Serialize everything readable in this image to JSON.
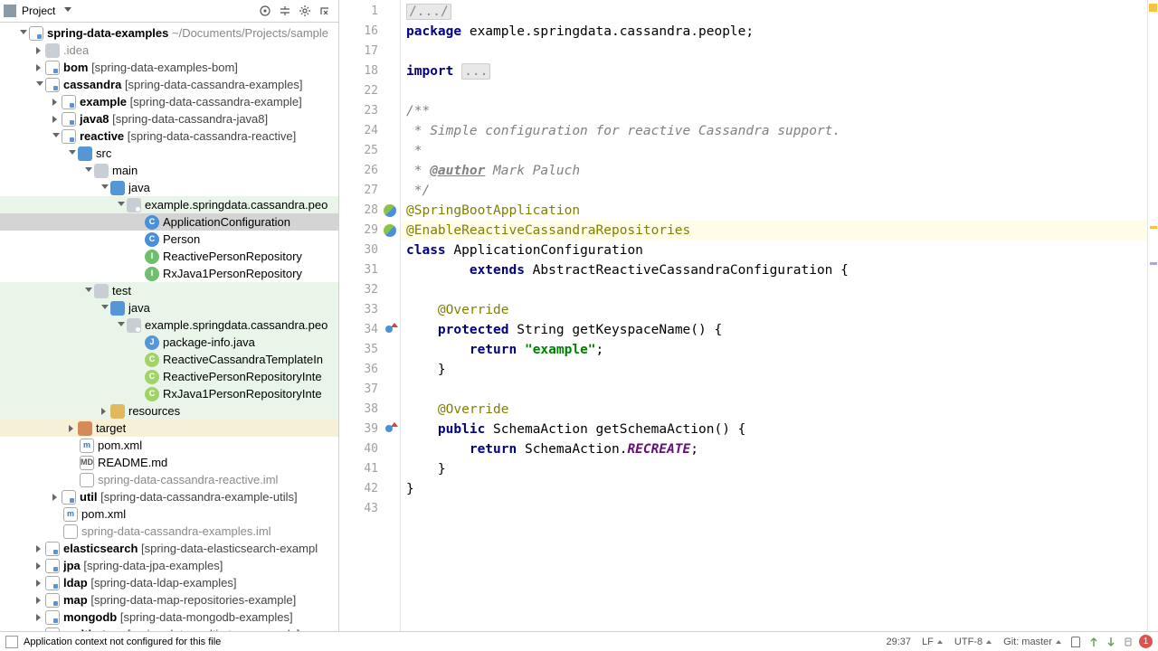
{
  "sidebar": {
    "title": "Project",
    "root": {
      "name": "spring-data-examples",
      "path": "~/Documents/Projects/sample"
    },
    "rows": [
      {
        "d": 1,
        "a": "down",
        "i": "module",
        "label": "spring-data-examples",
        "suffix": "~/Documents/Projects/sample",
        "bold": true,
        "part2": ""
      },
      {
        "d": 2,
        "a": "right",
        "i": "folder",
        "label": ".idea",
        "dim": true
      },
      {
        "d": 2,
        "a": "right",
        "i": "module",
        "label": "bom ",
        "part2": "[spring-data-examples-bom]",
        "bold": true
      },
      {
        "d": 2,
        "a": "down",
        "i": "module",
        "label": "cassandra ",
        "part2": "[spring-data-cassandra-examples]",
        "bold": true
      },
      {
        "d": 3,
        "a": "right",
        "i": "module",
        "label": "example ",
        "part2": "[spring-data-cassandra-example]",
        "bold": true
      },
      {
        "d": 3,
        "a": "right",
        "i": "module",
        "label": "java8 ",
        "part2": "[spring-data-cassandra-java8]",
        "bold": true
      },
      {
        "d": 3,
        "a": "down",
        "i": "module",
        "label": "reactive ",
        "part2": "[spring-data-cassandra-reactive]",
        "bold": true
      },
      {
        "d": 4,
        "a": "down",
        "i": "folder-src",
        "label": "src"
      },
      {
        "d": 5,
        "a": "down",
        "i": "folder",
        "label": "main"
      },
      {
        "d": 6,
        "a": "down",
        "i": "folder-src",
        "label": "java"
      },
      {
        "d": 7,
        "a": "down",
        "i": "folder-pkg",
        "label": "example.springdata.cassandra.peo",
        "hl": "green"
      },
      {
        "d": 8,
        "a": "none",
        "i": "class-c",
        "label": "ApplicationConfiguration",
        "sel": true
      },
      {
        "d": 8,
        "a": "none",
        "i": "class-c",
        "label": "Person"
      },
      {
        "d": 8,
        "a": "none",
        "i": "class-i",
        "label": "ReactivePersonRepository"
      },
      {
        "d": 8,
        "a": "none",
        "i": "class-i",
        "label": "RxJava1PersonRepository"
      },
      {
        "d": 5,
        "a": "down",
        "i": "folder",
        "label": "test",
        "hl": "green"
      },
      {
        "d": 6,
        "a": "down",
        "i": "folder-src",
        "label": "java",
        "hl": "green"
      },
      {
        "d": 7,
        "a": "down",
        "i": "folder-pkg",
        "label": "example.springdata.cassandra.peo",
        "hl": "green"
      },
      {
        "d": 8,
        "a": "none",
        "i": "java",
        "label": "package-info.java",
        "hl": "green"
      },
      {
        "d": 8,
        "a": "none",
        "i": "class-cg",
        "label": "ReactiveCassandraTemplateIn",
        "hl": "green"
      },
      {
        "d": 8,
        "a": "none",
        "i": "class-cg",
        "label": "ReactivePersonRepositoryInte",
        "hl": "green"
      },
      {
        "d": 8,
        "a": "none",
        "i": "class-cg",
        "label": "RxJava1PersonRepositoryInte",
        "hl": "green"
      },
      {
        "d": 6,
        "a": "right",
        "i": "folder-res",
        "label": "resources",
        "hl": "green"
      },
      {
        "d": 4,
        "a": "right",
        "i": "folder-tgt",
        "label": "target",
        "hl": "yellow"
      },
      {
        "d": 4,
        "a": "none",
        "i": "maven",
        "label": "pom.xml",
        "ic_text": "m"
      },
      {
        "d": 4,
        "a": "none",
        "i": "readme",
        "label": "README.md",
        "ic_text": "MD"
      },
      {
        "d": 4,
        "a": "none",
        "i": "iml",
        "label": "spring-data-cassandra-reactive.iml",
        "dim": true
      },
      {
        "d": 3,
        "a": "right",
        "i": "module",
        "label": "util ",
        "part2": "[spring-data-cassandra-example-utils]",
        "bold": true
      },
      {
        "d": 3,
        "a": "none",
        "i": "maven",
        "label": "pom.xml",
        "ic_text": "m"
      },
      {
        "d": 3,
        "a": "none",
        "i": "iml",
        "label": "spring-data-cassandra-examples.iml",
        "dim": true
      },
      {
        "d": 2,
        "a": "right",
        "i": "module",
        "label": "elasticsearch ",
        "part2": "[spring-data-elasticsearch-exampl",
        "bold": true
      },
      {
        "d": 2,
        "a": "right",
        "i": "module",
        "label": "jpa ",
        "part2": "[spring-data-jpa-examples]",
        "bold": true
      },
      {
        "d": 2,
        "a": "right",
        "i": "module",
        "label": "ldap ",
        "part2": "[spring-data-ldap-examples]",
        "bold": true
      },
      {
        "d": 2,
        "a": "right",
        "i": "module",
        "label": "map ",
        "part2": "[spring-data-map-repositories-example]",
        "bold": true
      },
      {
        "d": 2,
        "a": "right",
        "i": "module",
        "label": "mongodb ",
        "part2": "[spring-data-mongodb-examples]",
        "bold": true
      },
      {
        "d": 2,
        "a": "right",
        "i": "module",
        "label": "multi-store ",
        "part2": "[spring-data-multi-store-example]",
        "bold": true
      }
    ]
  },
  "editor": {
    "lines": [
      {
        "n": 1,
        "t": [
          {
            "c": "folded",
            "v": "/.../"
          }
        ]
      },
      {
        "n": 16,
        "t": [
          {
            "c": "kw",
            "v": "package"
          },
          {
            "c": "",
            "v": " example.springdata.cassandra.people;"
          }
        ]
      },
      {
        "n": 17,
        "t": []
      },
      {
        "n": 18,
        "t": [
          {
            "c": "kw",
            "v": "import"
          },
          {
            "c": "",
            "v": " "
          },
          {
            "c": "folded",
            "v": "..."
          }
        ]
      },
      {
        "n": 22,
        "t": []
      },
      {
        "n": 23,
        "t": [
          {
            "c": "com",
            "v": "/**"
          }
        ]
      },
      {
        "n": 24,
        "t": [
          {
            "c": "com",
            "v": " * Simple configuration for reactive Cassandra support."
          }
        ]
      },
      {
        "n": 25,
        "t": [
          {
            "c": "com",
            "v": " *"
          }
        ]
      },
      {
        "n": 26,
        "t": [
          {
            "c": "com",
            "v": " * "
          },
          {
            "c": "com-tag",
            "v": "@author"
          },
          {
            "c": "com",
            "v": " Mark Paluch"
          }
        ]
      },
      {
        "n": 27,
        "t": [
          {
            "c": "com",
            "v": " */"
          }
        ]
      },
      {
        "n": 28,
        "gi": "run",
        "t": [
          {
            "c": "ann",
            "v": "@SpringBootApplication"
          }
        ]
      },
      {
        "n": 29,
        "gi": "run",
        "hl": true,
        "t": [
          {
            "c": "ann",
            "v": "@EnableReactiveCassandraRepositories"
          }
        ]
      },
      {
        "n": 30,
        "t": [
          {
            "c": "kw",
            "v": "class"
          },
          {
            "c": "",
            "v": " "
          },
          {
            "c": "type",
            "v": "ApplicationConfiguration"
          }
        ]
      },
      {
        "n": 31,
        "t": [
          {
            "c": "",
            "v": "        "
          },
          {
            "c": "kw",
            "v": "extends"
          },
          {
            "c": "",
            "v": " AbstractReactiveCassandraConfiguration {"
          }
        ]
      },
      {
        "n": 32,
        "t": []
      },
      {
        "n": 33,
        "t": [
          {
            "c": "",
            "v": "    "
          },
          {
            "c": "ann",
            "v": "@Override"
          }
        ]
      },
      {
        "n": 34,
        "gi": "ov",
        "t": [
          {
            "c": "",
            "v": "    "
          },
          {
            "c": "kw",
            "v": "protected"
          },
          {
            "c": "",
            "v": " String getKeyspaceName() {"
          }
        ]
      },
      {
        "n": 35,
        "t": [
          {
            "c": "",
            "v": "        "
          },
          {
            "c": "kw",
            "v": "return"
          },
          {
            "c": "",
            "v": " "
          },
          {
            "c": "str",
            "v": "\"example\""
          },
          {
            "c": "",
            "v": ";"
          }
        ]
      },
      {
        "n": 36,
        "t": [
          {
            "c": "",
            "v": "    }"
          }
        ]
      },
      {
        "n": 37,
        "t": []
      },
      {
        "n": 38,
        "t": [
          {
            "c": "",
            "v": "    "
          },
          {
            "c": "ann",
            "v": "@Override"
          }
        ]
      },
      {
        "n": 39,
        "gi": "ov",
        "t": [
          {
            "c": "",
            "v": "    "
          },
          {
            "c": "kw",
            "v": "public"
          },
          {
            "c": "",
            "v": " SchemaAction getSchemaAction() {"
          }
        ]
      },
      {
        "n": 40,
        "t": [
          {
            "c": "",
            "v": "        "
          },
          {
            "c": "kw",
            "v": "return"
          },
          {
            "c": "",
            "v": " SchemaAction."
          },
          {
            "c": "static",
            "v": "RECREATE"
          },
          {
            "c": "",
            "v": ";"
          }
        ]
      },
      {
        "n": 41,
        "t": [
          {
            "c": "",
            "v": "    }"
          }
        ]
      },
      {
        "n": 42,
        "t": [
          {
            "c": "",
            "v": "}"
          }
        ]
      },
      {
        "n": 43,
        "t": []
      }
    ]
  },
  "status": {
    "message": "Application context not configured for this file",
    "pos": "29:37",
    "sep": "LF",
    "enc": "UTF-8",
    "git": "Git: master",
    "notif": "1"
  }
}
